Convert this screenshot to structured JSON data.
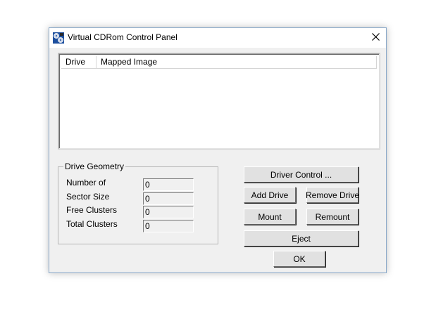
{
  "window": {
    "title": "Virtual CDRom Control Panel",
    "app_icon": "cd-drive-icon",
    "close_icon": "close-icon"
  },
  "list": {
    "columns": [
      "Drive",
      "Mapped Image"
    ],
    "rows": []
  },
  "geometry": {
    "title": "Drive Geometry",
    "fields": [
      {
        "label": "Number of",
        "value": "0"
      },
      {
        "label": "Sector Size",
        "value": "0"
      },
      {
        "label": "Free Clusters",
        "value": "0"
      },
      {
        "label": "Total Clusters",
        "value": "0"
      }
    ]
  },
  "buttons": {
    "driver_control": "Driver Control ...",
    "add_drive": "Add Drive",
    "remove_drive": "Remove Drive",
    "mount": "Mount",
    "remount": "Remount",
    "eject": "Eject",
    "ok": "OK"
  }
}
